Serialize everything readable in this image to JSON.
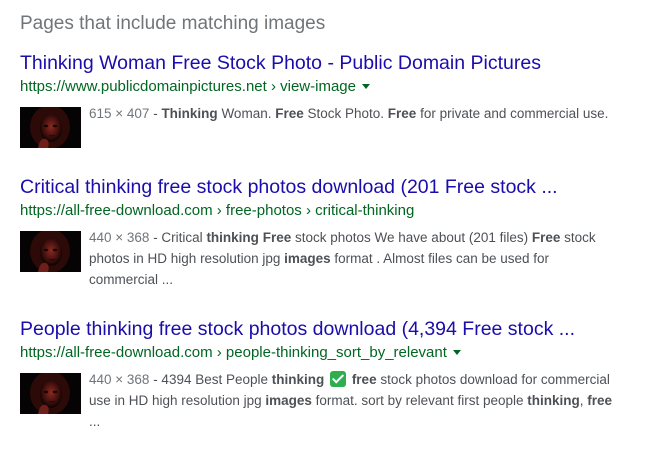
{
  "section": {
    "title": "Pages that include matching images"
  },
  "results": [
    {
      "title": "Thinking Woman Free Stock Photo - Public Domain Pictures",
      "url": "https://www.publicdomainpictures.net › view-image",
      "has_menu": true,
      "dimensions": "615 × 407",
      "snippet_parts": [
        {
          "t": " - ",
          "b": false
        },
        {
          "t": "Thinking",
          "b": true
        },
        {
          "t": " Woman. ",
          "b": false
        },
        {
          "t": "Free",
          "b": true
        },
        {
          "t": " Stock Photo. ",
          "b": false
        },
        {
          "t": "Free",
          "b": true
        },
        {
          "t": " for private and commercial use.",
          "b": false
        }
      ]
    },
    {
      "title": "Critical thinking free stock photos download (201 Free stock ...",
      "url": "https://all-free-download.com › free-photos › critical-thinking",
      "has_menu": false,
      "dimensions": "440 × 368",
      "snippet_parts": [
        {
          "t": " - Critical ",
          "b": false
        },
        {
          "t": "thinking",
          "b": true
        },
        {
          "t": " ",
          "b": false
        },
        {
          "t": "Free",
          "b": true
        },
        {
          "t": " stock photos We have about (201 files) ",
          "b": false
        },
        {
          "t": "Free",
          "b": true
        },
        {
          "t": " stock photos in HD high resolution jpg ",
          "b": false
        },
        {
          "t": "images",
          "b": true
        },
        {
          "t": " format . Almost files can be used for commercial ...",
          "b": false
        }
      ]
    },
    {
      "title": "People thinking free stock photos download (4,394 Free stock ...",
      "url": "https://all-free-download.com › people-thinking_sort_by_relevant",
      "has_menu": true,
      "dimensions": "440 × 368",
      "snippet_parts": [
        {
          "t": " - 4394 Best People ",
          "b": false
        },
        {
          "t": "thinking",
          "b": true
        },
        {
          "t": " ",
          "b": false
        },
        {
          "check": true
        },
        {
          "t": " ",
          "b": false
        },
        {
          "t": "free",
          "b": true
        },
        {
          "t": " stock photos download for commercial use in HD high resolution jpg ",
          "b": false
        },
        {
          "t": "images",
          "b": true
        },
        {
          "t": " format. sort by relevant first people ",
          "b": false
        },
        {
          "t": "thinking",
          "b": true
        },
        {
          "t": ", ",
          "b": false
        },
        {
          "t": "free",
          "b": true
        },
        {
          "t": " ...",
          "b": false
        }
      ]
    }
  ],
  "icons": {
    "menu": "caret-down-icon",
    "check": "check-mark-emoji-icon"
  },
  "colors": {
    "title_link": "#1a0dab",
    "url": "#006621",
    "snippet": "#4d5156",
    "section_title": "#70757a",
    "check_bg": "#2fae4e"
  }
}
